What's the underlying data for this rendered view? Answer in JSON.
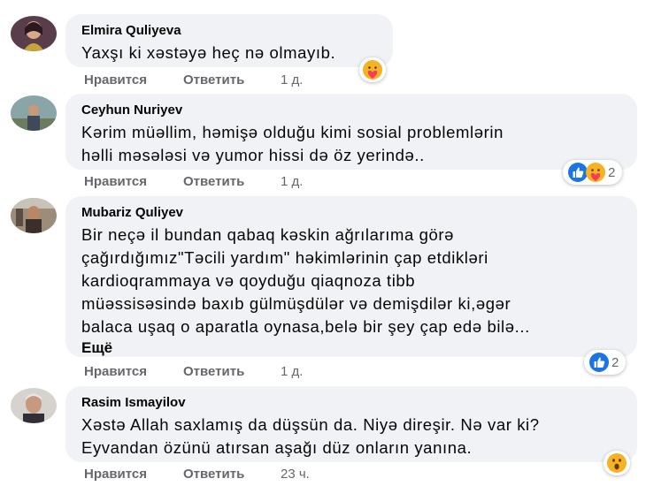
{
  "comments": [
    {
      "author": "Elmira Quliyeva",
      "lines": [
        "Yaxşı ki xəstəyə heç nə olmayıb."
      ],
      "more_label": "",
      "like_label": "Нравится",
      "reply_label": "Ответить",
      "time": "1 д.",
      "reactions": [
        "care-icon"
      ],
      "reaction_count": ""
    },
    {
      "author": "Ceyhun Nuriyev",
      "lines": [
        "Kərim müəllim, həmişə olduğu kimi sosial problemlərin",
        "həlli məsələsi və yumor hissi də öz yerində.."
      ],
      "more_label": "",
      "like_label": "Нравится",
      "reply_label": "Ответить",
      "time": "1 д.",
      "reactions": [
        "like-icon",
        "care-icon"
      ],
      "reaction_count": "2"
    },
    {
      "author": "Mubariz Quliyev",
      "lines": [
        "Bir neçə il bundan qabaq kəskin ağrılarıma görə",
        "çağırdığımız\"Təcili yardım\" həkimlərinin çap etdikləri",
        "kardioqrammaya və qoyduğu qiaqnoza tibb",
        "müəssisəsində baxıb gülmüşdülər və demişdilər ki,əgər",
        "balaca uşaq o aparatla oynasa,belə bir şey çap edə bilə..."
      ],
      "more_label": "Ещё",
      "like_label": "Нравится",
      "reply_label": "Ответить",
      "time": "1 д.",
      "reactions": [
        "like-icon"
      ],
      "reaction_count": "2"
    },
    {
      "author": "Rasim Ismayilov",
      "lines": [
        "Xəstə Allah saxlamış da düşsün da. Niyə direşir. Nə var ki?",
        "Eyvandan özünü atırsan aşağı düz onların yanına."
      ],
      "more_label": "",
      "like_label": "Нравится",
      "reply_label": "Ответить",
      "time": "23 ч.",
      "reactions": [
        "wow-icon"
      ],
      "reaction_count": ""
    }
  ],
  "colors": {
    "bubble": "#f0f2f5",
    "meta": "#65676b",
    "like_blue": "#1b74e4",
    "care_yellow": "#f7b125",
    "care_heart": "#f33e58"
  }
}
